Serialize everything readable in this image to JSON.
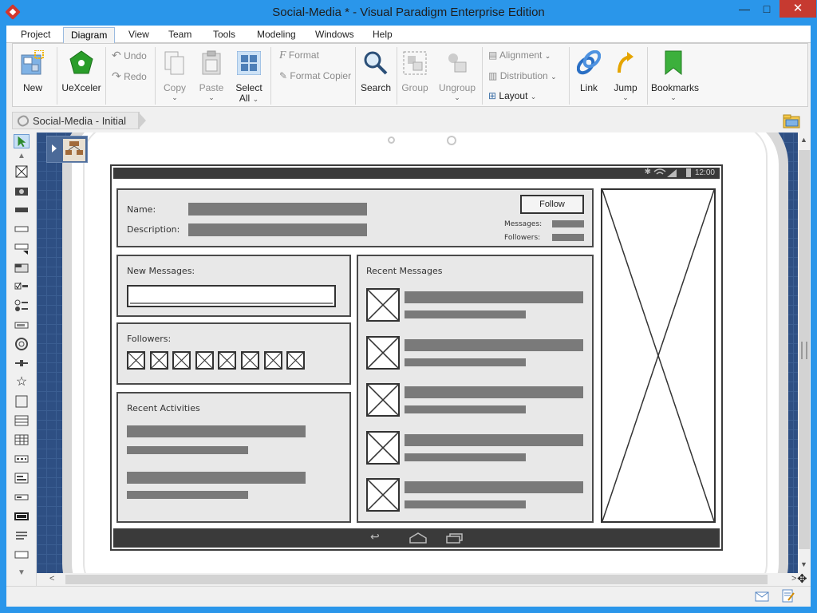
{
  "window": {
    "title": "Social-Media * - Visual Paradigm Enterprise Edition",
    "minimize_glyph": "—",
    "maximize_glyph": "□",
    "close_glyph": "✕"
  },
  "menu": {
    "tabs": [
      "Project",
      "Diagram",
      "View",
      "Team",
      "Tools",
      "Modeling",
      "Windows",
      "Help"
    ],
    "active": "Diagram"
  },
  "ribbon": {
    "new": "New",
    "uexceler": "UeXceler",
    "undo": "Undo",
    "redo": "Redo",
    "copy": "Copy",
    "paste": "Paste",
    "select_all_line1": "Select",
    "select_all_line2": "All",
    "format": "Format",
    "format_copier": "Format Copier",
    "search": "Search",
    "group": "Group",
    "ungroup": "Ungroup",
    "alignment": "Alignment",
    "distribution": "Distribution",
    "layout": "Layout",
    "link": "Link",
    "jump": "Jump",
    "bookmarks": "Bookmarks"
  },
  "breadcrumb": {
    "label": "Social-Media - Initial"
  },
  "wireframe": {
    "clock": "12:00",
    "profile": {
      "name_label": "Name:",
      "description_label": "Description:",
      "follow_button": "Follow",
      "messages_label": "Messages:",
      "followers_label": "Followers:"
    },
    "new_messages_title": "New Messages:",
    "followers_title": "Followers:",
    "recent_activities_title": "Recent Activities",
    "recent_messages_title": "Recent Messages",
    "follower_thumbnail_count": 8,
    "message_item_count": 5
  },
  "colors": {
    "titlebar": "#2a96ea",
    "close_button": "#c63a30",
    "canvas_grid": "#2e4f83",
    "wire_bar": "#7a7a7a"
  }
}
